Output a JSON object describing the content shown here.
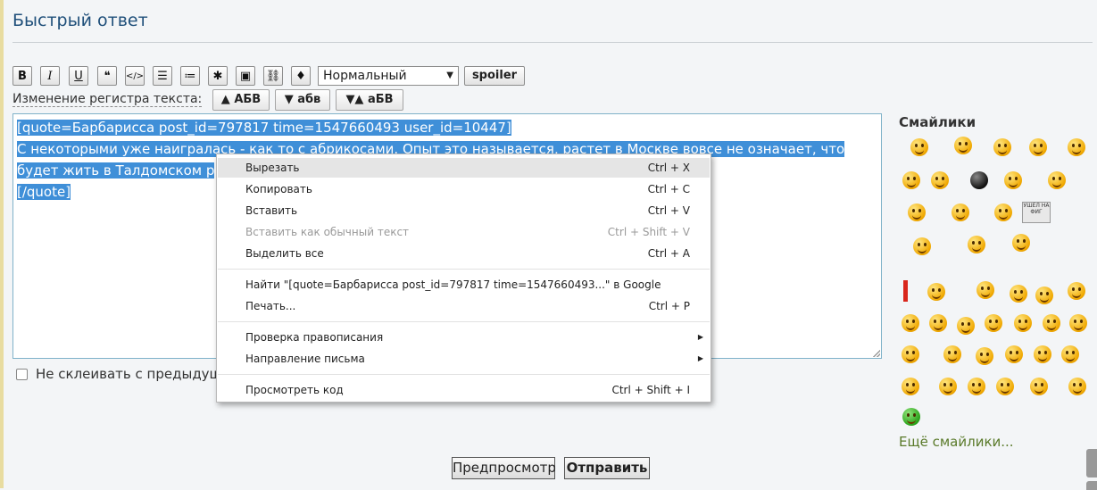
{
  "header": {
    "title": "Быстрый ответ"
  },
  "toolbar": {
    "buttons": [
      {
        "label": "B",
        "icon": "bold-icon"
      },
      {
        "label": "I",
        "icon": "italic-icon"
      },
      {
        "label": "U",
        "icon": "underline-icon"
      },
      {
        "label": "❝",
        "icon": "quote-icon"
      },
      {
        "label": "</>",
        "icon": "code-icon"
      },
      {
        "label": "☰",
        "icon": "bulleted-list-icon"
      },
      {
        "label": "≔",
        "icon": "numbered-list-icon"
      },
      {
        "label": "✱",
        "icon": "asterisk-icon"
      },
      {
        "label": "▣",
        "icon": "image-icon"
      },
      {
        "label": "⛓",
        "icon": "link-icon"
      },
      {
        "label": "♦",
        "icon": "color-icon"
      }
    ],
    "format_select": "Нормальный",
    "spoiler_label": "spoiler"
  },
  "case_change": {
    "label": "Изменение регистра текста:",
    "upper": "▲ АБВ",
    "lower": "▼ абв",
    "toggle": "▼▲ аБВ"
  },
  "editor": {
    "line1": "[quote=Барбарисса post_id=797817 time=1547660493 user_id=10447]",
    "line2": "С некоторыми уже наигралась - как то с абрикосами. Опыт это называется, растет в Москве вовсе не означает, что",
    "line3": "будет жить в Талдомском р",
    "line4": "[/quote]"
  },
  "options": {
    "no_merge_label": "Не склеивать с предыдущи"
  },
  "smilies": {
    "title": "Смайлики",
    "sign_text": "УШЕЛ НА ФИГ",
    "more_label": "Ещё смайлики..."
  },
  "actions": {
    "preview_label": "Предпросмотр",
    "send_label": "Отправить"
  },
  "context_menu": {
    "items": [
      {
        "label": "Вырезать",
        "shortcut": "Ctrl + X"
      },
      {
        "label": "Копировать",
        "shortcut": "Ctrl + C"
      },
      {
        "label": "Вставить",
        "shortcut": "Ctrl + V"
      },
      {
        "label": "Вставить как обычный текст",
        "shortcut": "Ctrl + Shift + V"
      },
      {
        "label": "Выделить все",
        "shortcut": "Ctrl + A"
      },
      {
        "label": "Найти \"[quote=Барбарисса post_id=797817 time=1547660493...\" в Google",
        "shortcut": ""
      },
      {
        "label": "Печать...",
        "shortcut": "Ctrl + P"
      },
      {
        "label": "Проверка правописания",
        "shortcut": ""
      },
      {
        "label": "Направление письма",
        "shortcut": ""
      },
      {
        "label": "Просмотреть код",
        "shortcut": "Ctrl + Shift + I"
      }
    ]
  }
}
